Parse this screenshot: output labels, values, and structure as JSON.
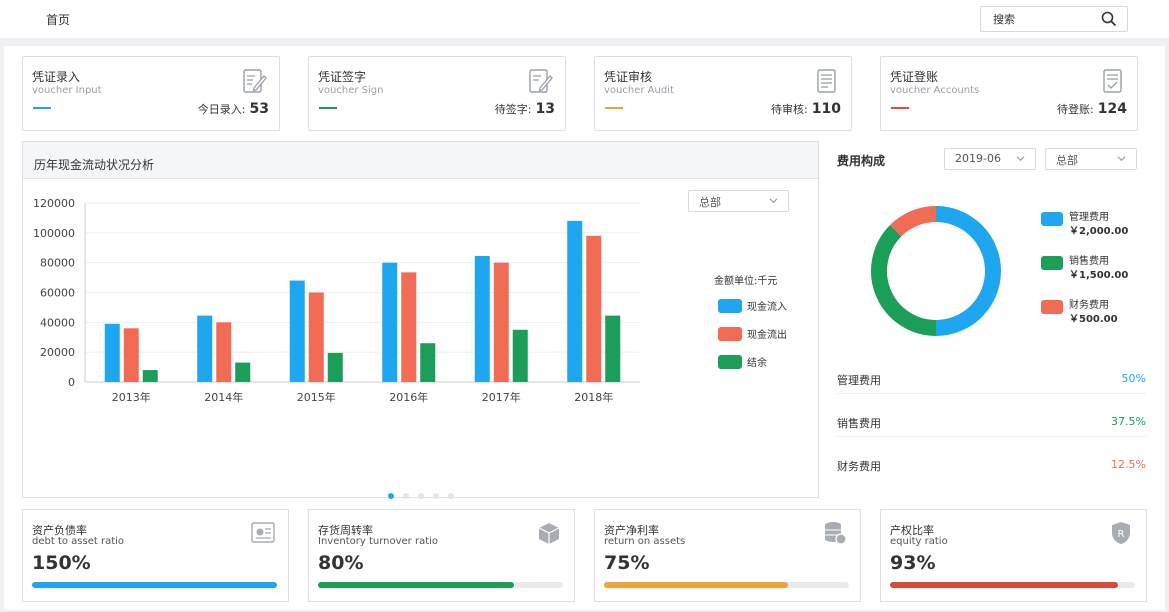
{
  "topbar": {
    "home": "首页",
    "search_placeholder": "搜索"
  },
  "vouchers": [
    {
      "title": "凭证录入",
      "subtitle": "voucher Input",
      "count_label": "今日录入:",
      "count": "53",
      "color": "#1ea7f0",
      "icon": "edit-document-icon"
    },
    {
      "title": "凭证签字",
      "subtitle": "voucher Sign",
      "count_label": "待签字:",
      "count": "13",
      "color": "#1a9e58",
      "icon": "sign-document-icon"
    },
    {
      "title": "凭证审核",
      "subtitle": "voucher Audit",
      "count_label": "待审核:",
      "count": "110",
      "color": "#f0a23a",
      "icon": "audit-document-icon"
    },
    {
      "title": "凭证登账",
      "subtitle": "voucher Accounts",
      "count_label": "待登账:",
      "count": "124",
      "color": "#e04b3c",
      "icon": "ledger-document-icon"
    }
  ],
  "cashflow": {
    "title": "历年现金流动状况分析",
    "select": "总部",
    "unit_label": "金额单位:千元"
  },
  "chart_data": {
    "type": "bar",
    "categories": [
      "2013年",
      "2014年",
      "2015年",
      "2016年",
      "2017年",
      "2018年"
    ],
    "series": [
      {
        "name": "现金流入",
        "color": "#1ea7f0",
        "values": [
          39000,
          44500,
          68000,
          80000,
          84500,
          108000
        ]
      },
      {
        "name": "现金流出",
        "color": "#f26b55",
        "values": [
          36000,
          40000,
          60000,
          73500,
          80000,
          98000
        ]
      },
      {
        "name": "结余",
        "color": "#1a9e58",
        "values": [
          8000,
          13000,
          19500,
          26000,
          35000,
          44500
        ]
      }
    ],
    "ylim": [
      0,
      120000
    ],
    "yticks": [
      "120000",
      "100000",
      "80000",
      "60000",
      "40000",
      "20000",
      "0"
    ],
    "grid": true,
    "legend": "right"
  },
  "cost": {
    "title": "费用构成",
    "month": "2019-06",
    "dept": "总部",
    "items": [
      {
        "name": "管理费用",
        "amount": "￥2,000.00",
        "value": 2000,
        "percent": "50%",
        "color": "#1ea7f0"
      },
      {
        "name": "销售费用",
        "amount": "￥1,500.00",
        "value": 1500,
        "percent": "37.5%",
        "color": "#1a9e58"
      },
      {
        "name": "财务费用",
        "amount": "￥500.00",
        "value": 500,
        "percent": "12.5%",
        "color": "#f26b55"
      }
    ]
  },
  "ratios": [
    {
      "title": "资产负债率",
      "subtitle": "debt to asset ratio",
      "value": "150%",
      "level": 1.0,
      "color": "#1ea7f0",
      "icon": "certificate-icon"
    },
    {
      "title": "存货周转率",
      "subtitle": "Inventory turnover ratio",
      "value": "80%",
      "level": 0.8,
      "color": "#1a9e58",
      "icon": "box-icon"
    },
    {
      "title": "资产净利率",
      "subtitle": "return on assets",
      "value": "75%",
      "level": 0.75,
      "color": "#f0a23a",
      "icon": "coins-icon"
    },
    {
      "title": "产权比率",
      "subtitle": "equity ratio",
      "value": "93%",
      "level": 0.93,
      "color": "#d84b38",
      "icon": "shield-icon"
    }
  ]
}
